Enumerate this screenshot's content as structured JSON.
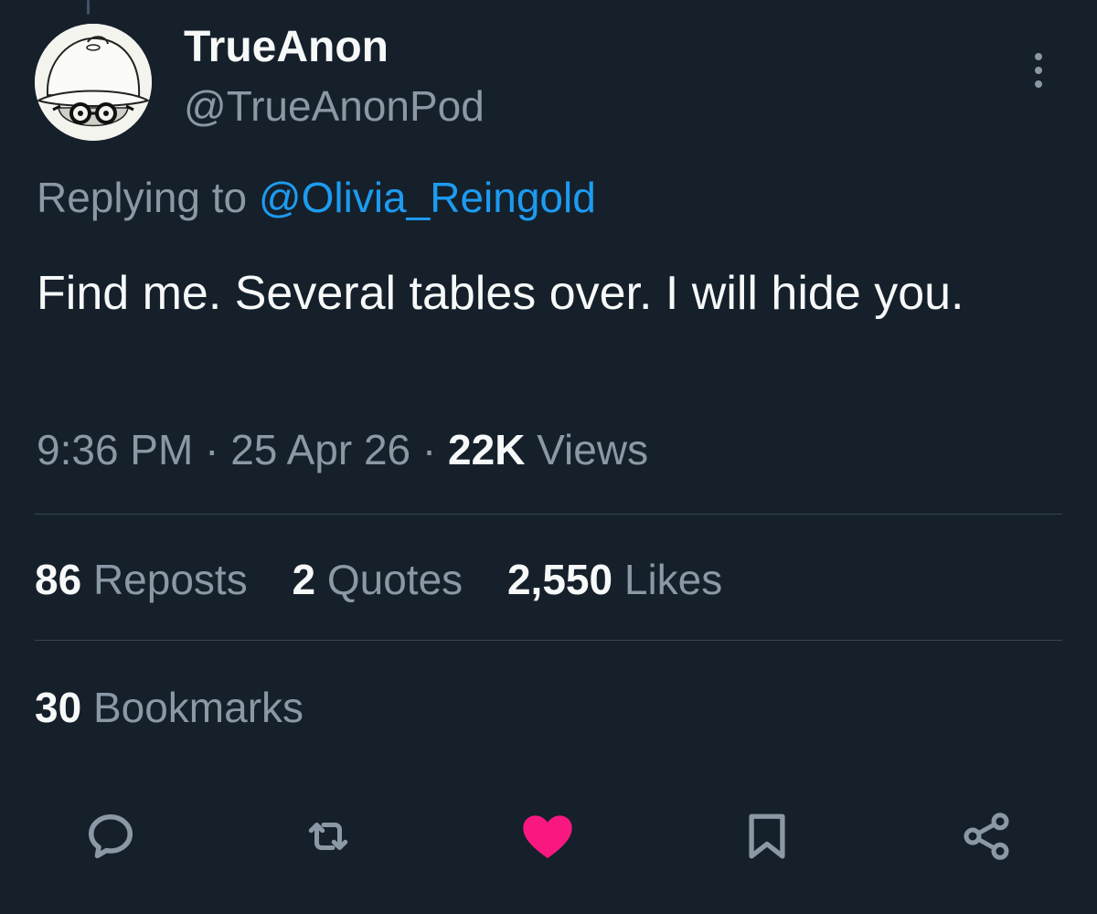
{
  "tweet": {
    "display_name": "TrueAnon",
    "handle": "@TrueAnonPod",
    "reply_prefix": "Replying to",
    "reply_to": "@Olivia_Reingold",
    "text": "Find me. Several tables over. I will hide you.",
    "time": "9:36 PM",
    "date": "25 Apr 26",
    "views_count": "22K",
    "views_label": "Views",
    "separator": "·"
  },
  "stats": {
    "reposts": {
      "count": "86",
      "label": "Reposts"
    },
    "quotes": {
      "count": "2",
      "label": "Quotes"
    },
    "likes": {
      "count": "2,550",
      "label": "Likes"
    },
    "bookmarks": {
      "count": "30",
      "label": "Bookmarks"
    }
  },
  "actions": {
    "reply_icon": "reply-icon",
    "repost_icon": "repost-icon",
    "like_icon": "heart-icon",
    "like_state": "liked",
    "bookmark_icon": "bookmark-icon",
    "share_icon": "share-icon"
  },
  "colors": {
    "background": "#15202b",
    "primary_text": "#f7f9f9",
    "secondary_text": "#8b98a5",
    "link": "#1d9bf0",
    "like": "#f91880",
    "divider": "#38444d"
  }
}
